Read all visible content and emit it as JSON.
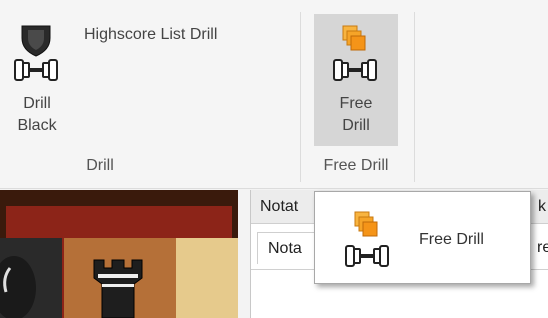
{
  "ribbon": {
    "drill_group": {
      "label": "Drill",
      "drill_black": {
        "line1": "Drill",
        "line2": "Black"
      },
      "highscore_list_drill": "Highscore List Drill"
    },
    "free_drill_group": {
      "label": "Free Drill",
      "free_drill": {
        "line1": "Free",
        "line2": "Drill"
      }
    }
  },
  "panel": {
    "header_title": "Notat",
    "header_right": "k",
    "tab_label": "Nota",
    "tab_right": "re"
  },
  "tooltip": {
    "text": "Free Drill"
  },
  "colors": {
    "ribbon_bg": "#f5f5f5",
    "pressed_button_bg": "#d6d6d6",
    "icon_orange": "#f5a020",
    "icon_dark": "#2a2a2a",
    "board_frame": "#8c2418"
  },
  "icons": {
    "drill_black": "shield-dumbbell-icon",
    "free_drill": "stacked-squares-dumbbell-icon",
    "tooltip": "stacked-squares-dumbbell-icon"
  }
}
